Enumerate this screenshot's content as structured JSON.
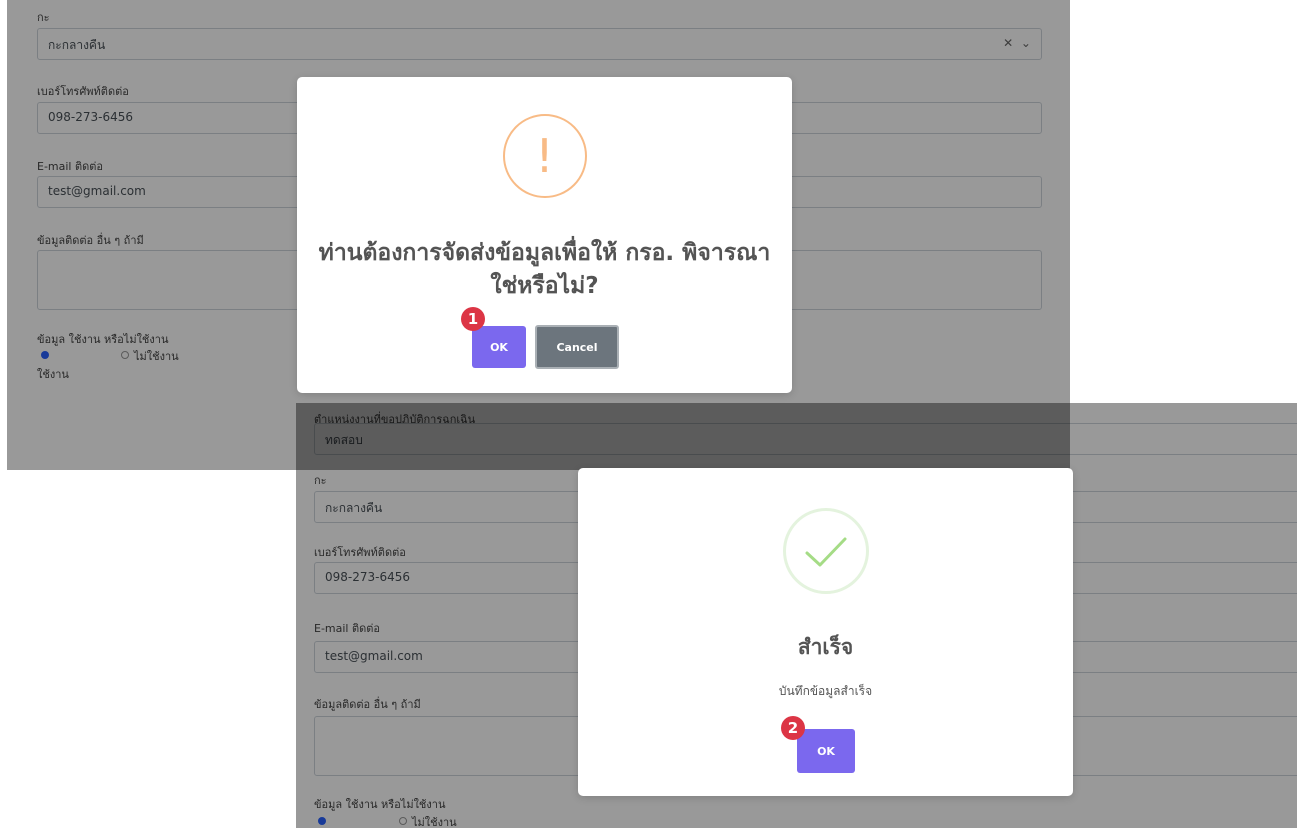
{
  "form_top": {
    "province_label": "กะ",
    "province_value": "กะกลางคืน",
    "phone_label": "เบอร์โทรศัพท์ติดต่อ",
    "phone_value": "098-273-6456",
    "email_label": "E-mail ติดต่อ",
    "email_value": "test@gmail.com",
    "other_label": "ข้อมูลติดต่อ อื่น ๆ ถ้ามี",
    "status_label": "ข้อมูล ใช้งาน หรือไม่ใช้งาน",
    "radio_active": "ใช้งาน",
    "radio_inactive": "ไม่ใช้งาน"
  },
  "form_bottom": {
    "unit_label": "ตำแหน่งงานที่ขอปฏิบัติการฉุกเฉิน",
    "unit_value": "ทดสอบ",
    "province_label": "กะ",
    "province_value": "กะกลางคืน",
    "phone_label": "เบอร์โทรศัพท์ติดต่อ",
    "phone_value": "098-273-6456",
    "email_label": "E-mail ติดต่อ",
    "email_value": "test@gmail.com",
    "other_label": "ข้อมูลติดต่อ อื่น ๆ ถ้ามี",
    "status_label": "ข้อมูล ใช้งาน หรือไม่ใช้งาน",
    "radio_inactive": "ไม่ใช้งาน"
  },
  "confirm_dialog": {
    "icon": "exclamation-icon",
    "icon_glyph": "!",
    "title": "ท่านต้องการจัดส่งข้อมูลเพื่อให้ กรอ. พิจารณาใช่หรือไม่?",
    "ok_label": "OK",
    "cancel_label": "Cancel",
    "step_number": "1"
  },
  "success_dialog": {
    "icon": "checkmark-icon",
    "title": "สำเร็จ",
    "message": "บันทึกข้อมูลสำเร็จ",
    "ok_label": "OK",
    "step_number": "2"
  },
  "colors": {
    "ok_button": "#7b68ee",
    "cancel_button": "#6c757d",
    "warning": "#f8bb86",
    "success": "#a5dc86",
    "step_badge": "#dc3545"
  }
}
